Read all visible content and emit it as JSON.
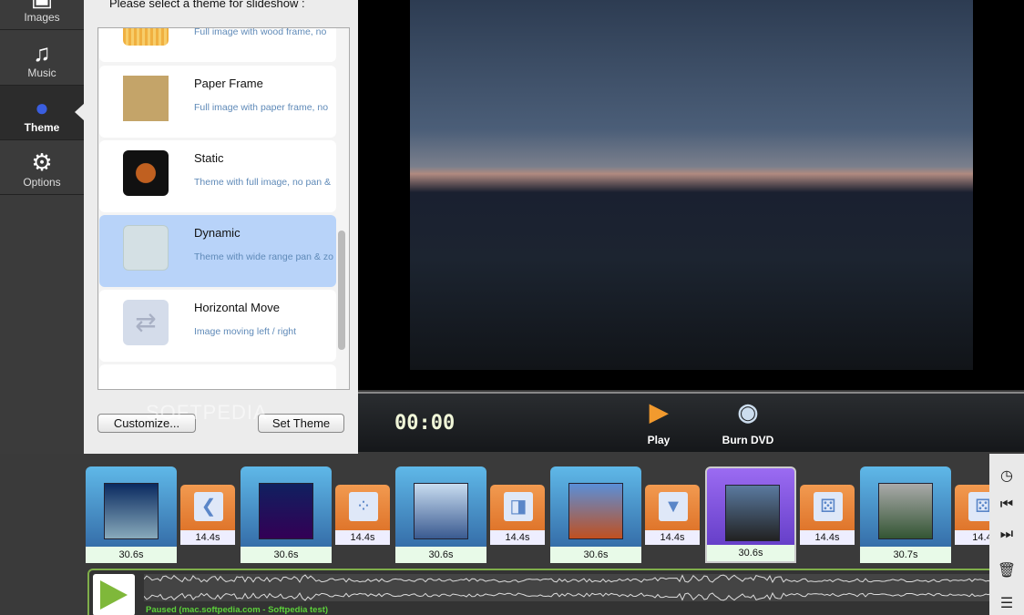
{
  "sidebar": {
    "items": [
      {
        "label": "Images",
        "icon": "image-icon"
      },
      {
        "label": "Music",
        "icon": "music-note-icon"
      },
      {
        "label": "Theme",
        "icon": "palette-icon",
        "selected": true
      },
      {
        "label": "Options",
        "icon": "gear-icon"
      }
    ]
  },
  "theme_panel": {
    "prompt": "Please select a theme for slideshow :",
    "themes": [
      {
        "name": "",
        "desc": "Full image with wood frame, no"
      },
      {
        "name": "Paper Frame",
        "desc": "Full image with paper frame, no"
      },
      {
        "name": "Static",
        "desc": "Theme with full image, no pan &"
      },
      {
        "name": "Dynamic",
        "desc": "Theme with wide range pan & zo",
        "selected": true
      },
      {
        "name": "Horizontal Move",
        "desc": "Image moving  left / right"
      }
    ],
    "customize_label": "Customize...",
    "set_theme_label": "Set Theme"
  },
  "watermark": "SOFTPEDIA",
  "controls": {
    "timer": "00:00",
    "play_label": "Play",
    "burn_label": "Burn DVD"
  },
  "timeline": {
    "slides": [
      {
        "dur": "30.6s"
      },
      {
        "dur": "30.6s"
      },
      {
        "dur": "30.6s"
      },
      {
        "dur": "30.6s"
      },
      {
        "dur": "30.6s",
        "selected": true
      },
      {
        "dur": "30.7s"
      }
    ],
    "transitions": [
      {
        "dur": "14.4s",
        "glyph": "❮"
      },
      {
        "dur": "14.4s",
        "glyph": "⁘"
      },
      {
        "dur": "14.4s",
        "glyph": "◨"
      },
      {
        "dur": "14.4s",
        "glyph": "▼"
      },
      {
        "dur": "14.4s",
        "glyph": "⚄"
      },
      {
        "dur": "14.4",
        "glyph": "⚄"
      }
    ]
  },
  "audio": {
    "status": "Paused (mac.softpedia.com - Softpedia test)"
  },
  "colors": {
    "accent_green": "#7fae4a",
    "selected_theme": "#b8d3f9",
    "selected_slide": "#7a4fe0"
  }
}
